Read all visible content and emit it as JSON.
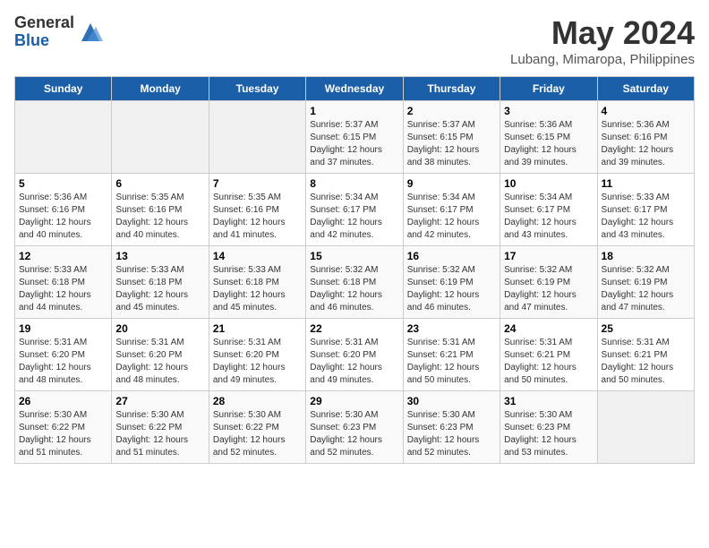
{
  "logo": {
    "general": "General",
    "blue": "Blue"
  },
  "title": "May 2024",
  "subtitle": "Lubang, Mimaropa, Philippines",
  "days_of_week": [
    "Sunday",
    "Monday",
    "Tuesday",
    "Wednesday",
    "Thursday",
    "Friday",
    "Saturday"
  ],
  "weeks": [
    [
      {
        "day": "",
        "info": ""
      },
      {
        "day": "",
        "info": ""
      },
      {
        "day": "",
        "info": ""
      },
      {
        "day": "1",
        "info": "Sunrise: 5:37 AM\nSunset: 6:15 PM\nDaylight: 12 hours and 37 minutes."
      },
      {
        "day": "2",
        "info": "Sunrise: 5:37 AM\nSunset: 6:15 PM\nDaylight: 12 hours and 38 minutes."
      },
      {
        "day": "3",
        "info": "Sunrise: 5:36 AM\nSunset: 6:15 PM\nDaylight: 12 hours and 39 minutes."
      },
      {
        "day": "4",
        "info": "Sunrise: 5:36 AM\nSunset: 6:16 PM\nDaylight: 12 hours and 39 minutes."
      }
    ],
    [
      {
        "day": "5",
        "info": "Sunrise: 5:36 AM\nSunset: 6:16 PM\nDaylight: 12 hours and 40 minutes."
      },
      {
        "day": "6",
        "info": "Sunrise: 5:35 AM\nSunset: 6:16 PM\nDaylight: 12 hours and 40 minutes."
      },
      {
        "day": "7",
        "info": "Sunrise: 5:35 AM\nSunset: 6:16 PM\nDaylight: 12 hours and 41 minutes."
      },
      {
        "day": "8",
        "info": "Sunrise: 5:34 AM\nSunset: 6:17 PM\nDaylight: 12 hours and 42 minutes."
      },
      {
        "day": "9",
        "info": "Sunrise: 5:34 AM\nSunset: 6:17 PM\nDaylight: 12 hours and 42 minutes."
      },
      {
        "day": "10",
        "info": "Sunrise: 5:34 AM\nSunset: 6:17 PM\nDaylight: 12 hours and 43 minutes."
      },
      {
        "day": "11",
        "info": "Sunrise: 5:33 AM\nSunset: 6:17 PM\nDaylight: 12 hours and 43 minutes."
      }
    ],
    [
      {
        "day": "12",
        "info": "Sunrise: 5:33 AM\nSunset: 6:18 PM\nDaylight: 12 hours and 44 minutes."
      },
      {
        "day": "13",
        "info": "Sunrise: 5:33 AM\nSunset: 6:18 PM\nDaylight: 12 hours and 45 minutes."
      },
      {
        "day": "14",
        "info": "Sunrise: 5:33 AM\nSunset: 6:18 PM\nDaylight: 12 hours and 45 minutes."
      },
      {
        "day": "15",
        "info": "Sunrise: 5:32 AM\nSunset: 6:18 PM\nDaylight: 12 hours and 46 minutes."
      },
      {
        "day": "16",
        "info": "Sunrise: 5:32 AM\nSunset: 6:19 PM\nDaylight: 12 hours and 46 minutes."
      },
      {
        "day": "17",
        "info": "Sunrise: 5:32 AM\nSunset: 6:19 PM\nDaylight: 12 hours and 47 minutes."
      },
      {
        "day": "18",
        "info": "Sunrise: 5:32 AM\nSunset: 6:19 PM\nDaylight: 12 hours and 47 minutes."
      }
    ],
    [
      {
        "day": "19",
        "info": "Sunrise: 5:31 AM\nSunset: 6:20 PM\nDaylight: 12 hours and 48 minutes."
      },
      {
        "day": "20",
        "info": "Sunrise: 5:31 AM\nSunset: 6:20 PM\nDaylight: 12 hours and 48 minutes."
      },
      {
        "day": "21",
        "info": "Sunrise: 5:31 AM\nSunset: 6:20 PM\nDaylight: 12 hours and 49 minutes."
      },
      {
        "day": "22",
        "info": "Sunrise: 5:31 AM\nSunset: 6:20 PM\nDaylight: 12 hours and 49 minutes."
      },
      {
        "day": "23",
        "info": "Sunrise: 5:31 AM\nSunset: 6:21 PM\nDaylight: 12 hours and 50 minutes."
      },
      {
        "day": "24",
        "info": "Sunrise: 5:31 AM\nSunset: 6:21 PM\nDaylight: 12 hours and 50 minutes."
      },
      {
        "day": "25",
        "info": "Sunrise: 5:31 AM\nSunset: 6:21 PM\nDaylight: 12 hours and 50 minutes."
      }
    ],
    [
      {
        "day": "26",
        "info": "Sunrise: 5:30 AM\nSunset: 6:22 PM\nDaylight: 12 hours and 51 minutes."
      },
      {
        "day": "27",
        "info": "Sunrise: 5:30 AM\nSunset: 6:22 PM\nDaylight: 12 hours and 51 minutes."
      },
      {
        "day": "28",
        "info": "Sunrise: 5:30 AM\nSunset: 6:22 PM\nDaylight: 12 hours and 52 minutes."
      },
      {
        "day": "29",
        "info": "Sunrise: 5:30 AM\nSunset: 6:23 PM\nDaylight: 12 hours and 52 minutes."
      },
      {
        "day": "30",
        "info": "Sunrise: 5:30 AM\nSunset: 6:23 PM\nDaylight: 12 hours and 52 minutes."
      },
      {
        "day": "31",
        "info": "Sunrise: 5:30 AM\nSunset: 6:23 PM\nDaylight: 12 hours and 53 minutes."
      },
      {
        "day": "",
        "info": ""
      }
    ]
  ]
}
